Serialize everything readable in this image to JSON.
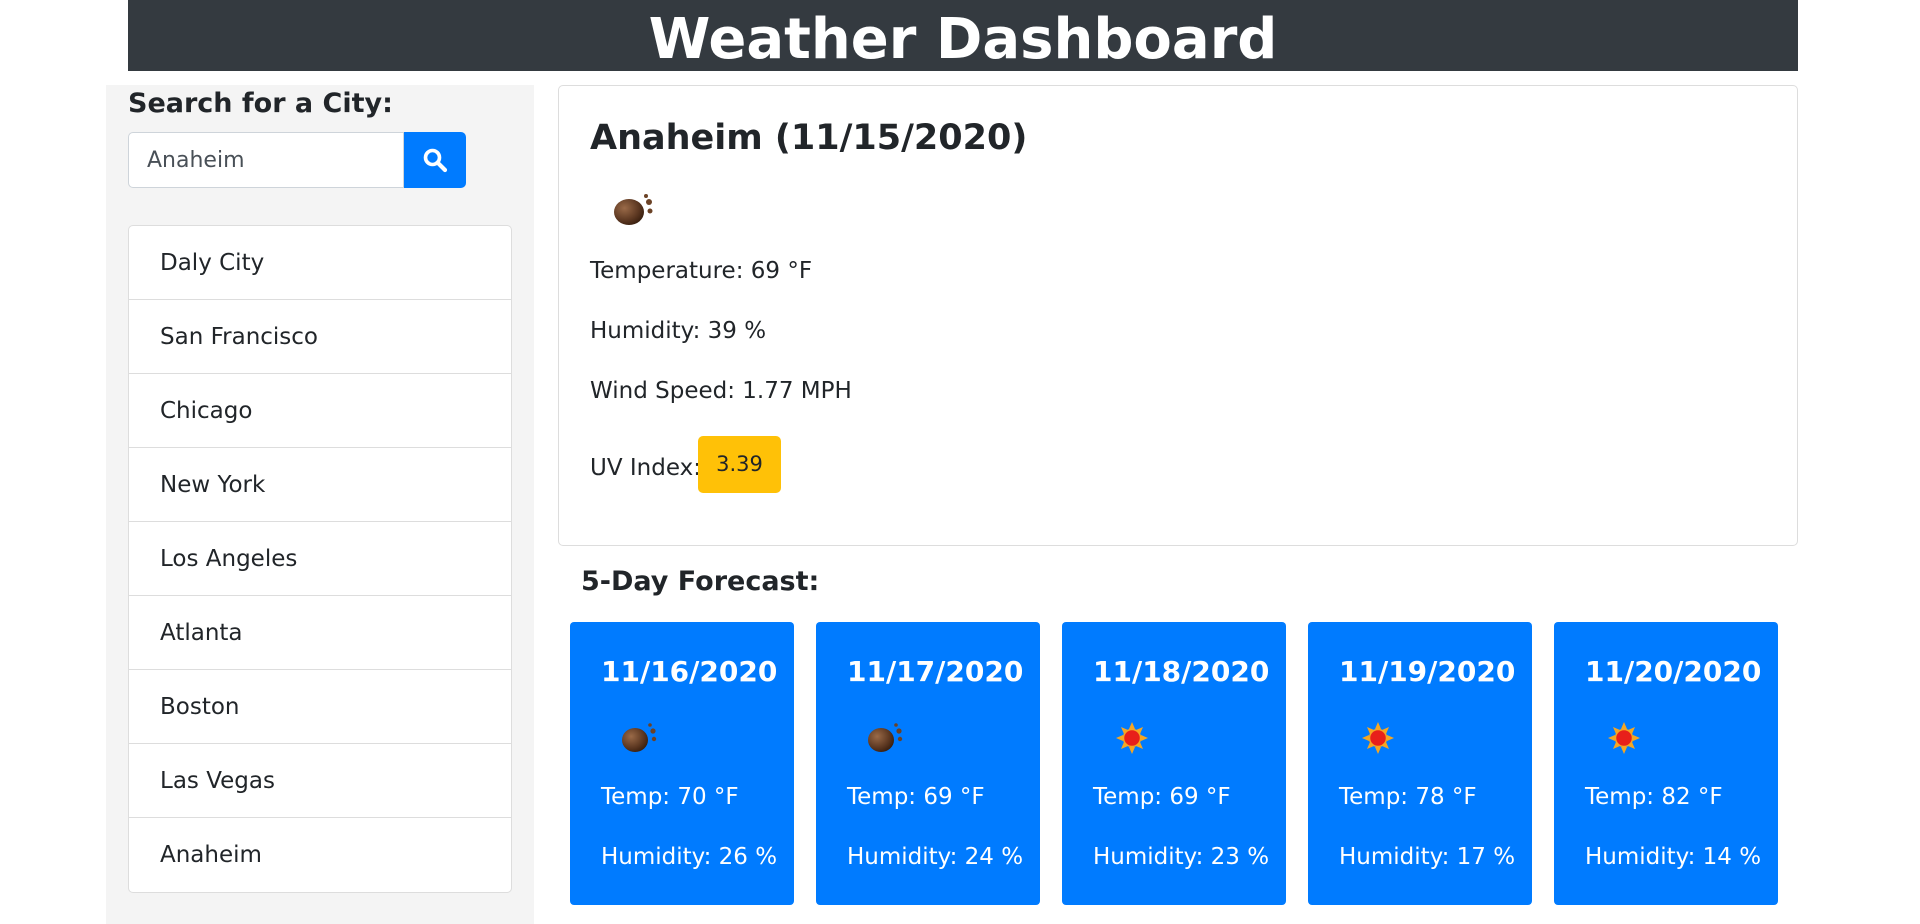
{
  "header": {
    "title": "Weather Dashboard"
  },
  "sidebar": {
    "search_heading": "Search for a City:",
    "search_value": "Anaheim",
    "search_icon": "search-icon",
    "cities": [
      "Daly City",
      "San Francisco",
      "Chicago",
      "New York",
      "Los Angeles",
      "Atlanta",
      "Boston",
      "Las Vegas",
      "Anaheim"
    ]
  },
  "current": {
    "title": "Anaheim (11/15/2020)",
    "icon": "haze-icon",
    "temperature": "Temperature: 69 °F",
    "humidity": "Humidity: 39 %",
    "wind": "Wind Speed: 1.77 MPH",
    "uv_label": "UV Index:",
    "uv_value": "3.39",
    "uv_color": "#ffc107"
  },
  "forecast": {
    "heading": "5-Day Forecast:",
    "days": [
      {
        "date": "11/16/2020",
        "icon": "haze-icon",
        "temp": "Temp: 70 °F",
        "humidity": "Humidity: 26 %"
      },
      {
        "date": "11/17/2020",
        "icon": "haze-icon",
        "temp": "Temp: 69 °F",
        "humidity": "Humidity: 24 %"
      },
      {
        "date": "11/18/2020",
        "icon": "sun-icon",
        "temp": "Temp: 69 °F",
        "humidity": "Humidity: 23 %"
      },
      {
        "date": "11/19/2020",
        "icon": "sun-icon",
        "temp": "Temp: 78 °F",
        "humidity": "Humidity: 17 %"
      },
      {
        "date": "11/20/2020",
        "icon": "sun-icon",
        "temp": "Temp: 82 °F",
        "humidity": "Humidity: 14 %"
      }
    ]
  },
  "colors": {
    "header_bg": "#343a40",
    "primary": "#007bff",
    "uv_moderate": "#ffc107"
  }
}
